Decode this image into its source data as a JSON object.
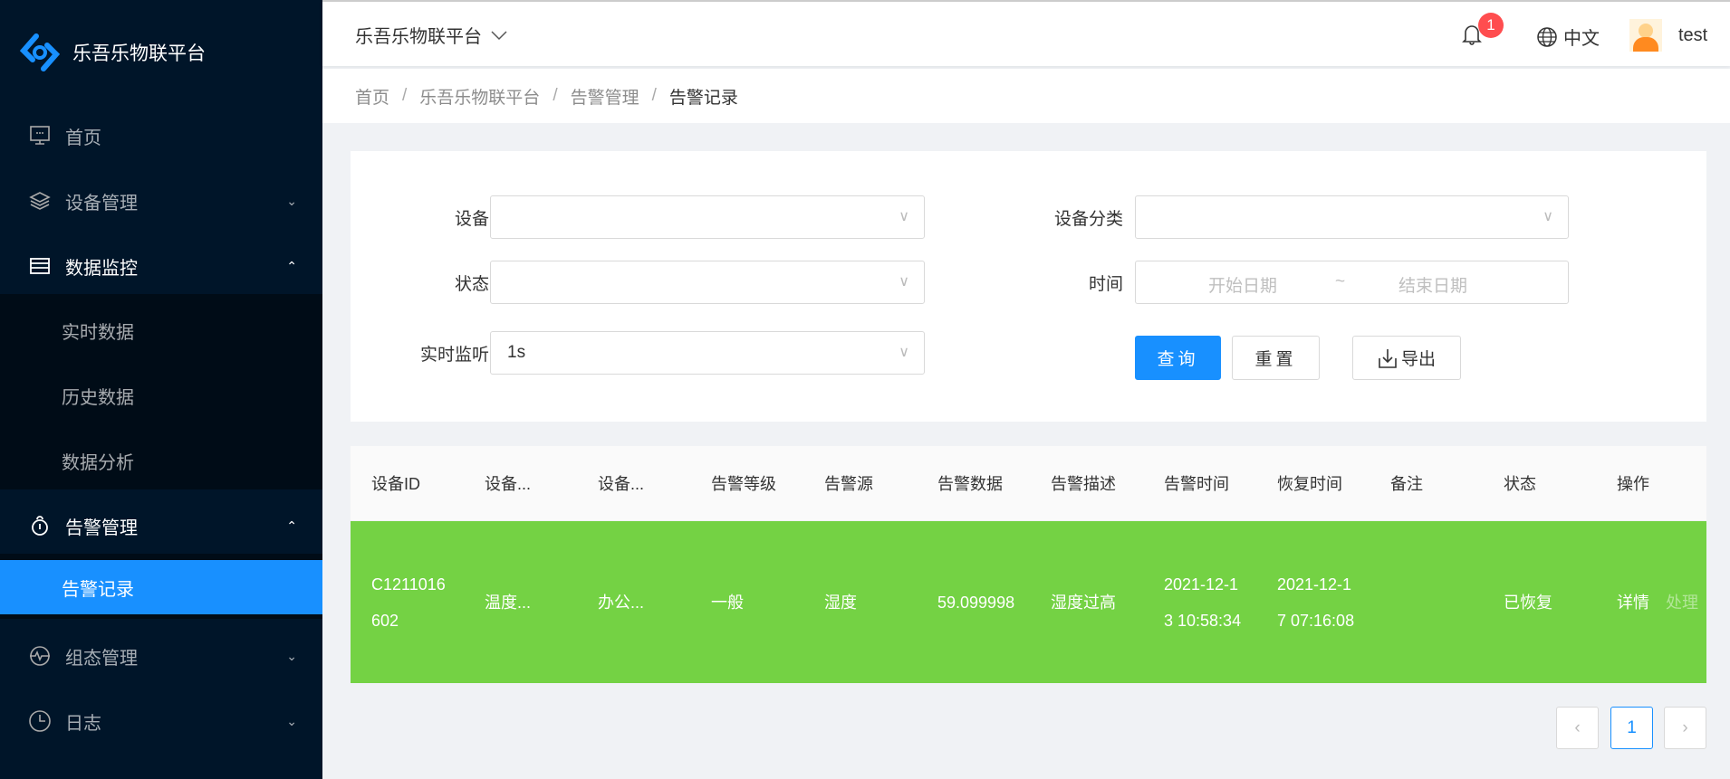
{
  "sidebar": {
    "logo_text": "乐吾乐物联平台",
    "items": [
      {
        "label": "首页"
      },
      {
        "label": "设备管理"
      },
      {
        "label": "数据监控",
        "children": [
          "实时数据",
          "历史数据",
          "数据分析"
        ]
      },
      {
        "label": "告警管理",
        "children": [
          "告警记录"
        ]
      },
      {
        "label": "组态管理"
      },
      {
        "label": "日志"
      }
    ]
  },
  "header": {
    "project": "乐吾乐物联平台",
    "notification_count": "1",
    "language": "中文",
    "user": "test"
  },
  "breadcrumb": [
    "首页",
    "乐吾乐物联平台",
    "告警管理",
    "告警记录"
  ],
  "filters": {
    "device_label": "设备",
    "device_value": "",
    "category_label": "设备分类",
    "category_value": "",
    "status_label": "状态",
    "status_value": "",
    "time_label": "时间",
    "start_placeholder": "开始日期",
    "range_sep": "~",
    "end_placeholder": "结束日期",
    "monitor_label": "实时监听",
    "monitor_value": "1s",
    "query": "查询",
    "reset": "重置",
    "export": "导出"
  },
  "table": {
    "columns": [
      "设备ID",
      "设备...",
      "设备...",
      "告警等级",
      "告警源",
      "告警数据",
      "告警描述",
      "告警时间",
      "恢复时间",
      "备注",
      "状态",
      "操作"
    ],
    "rows": [
      {
        "cells": [
          "C1211016602",
          "温度...",
          "办公...",
          "一般",
          "湿度",
          "59.099998",
          "湿度过高",
          "2021-12-13 10:58:34",
          "2021-12-17 07:16:08",
          "",
          "已恢复"
        ],
        "actions": [
          "详情",
          "处理"
        ],
        "row_color": "#74d244"
      }
    ]
  },
  "pagination": {
    "current": "1"
  },
  "colors": {
    "accent": "#1890ff",
    "sidebar": "#001529",
    "row_recovered": "#74d244",
    "badge": "#ff4d4f"
  }
}
